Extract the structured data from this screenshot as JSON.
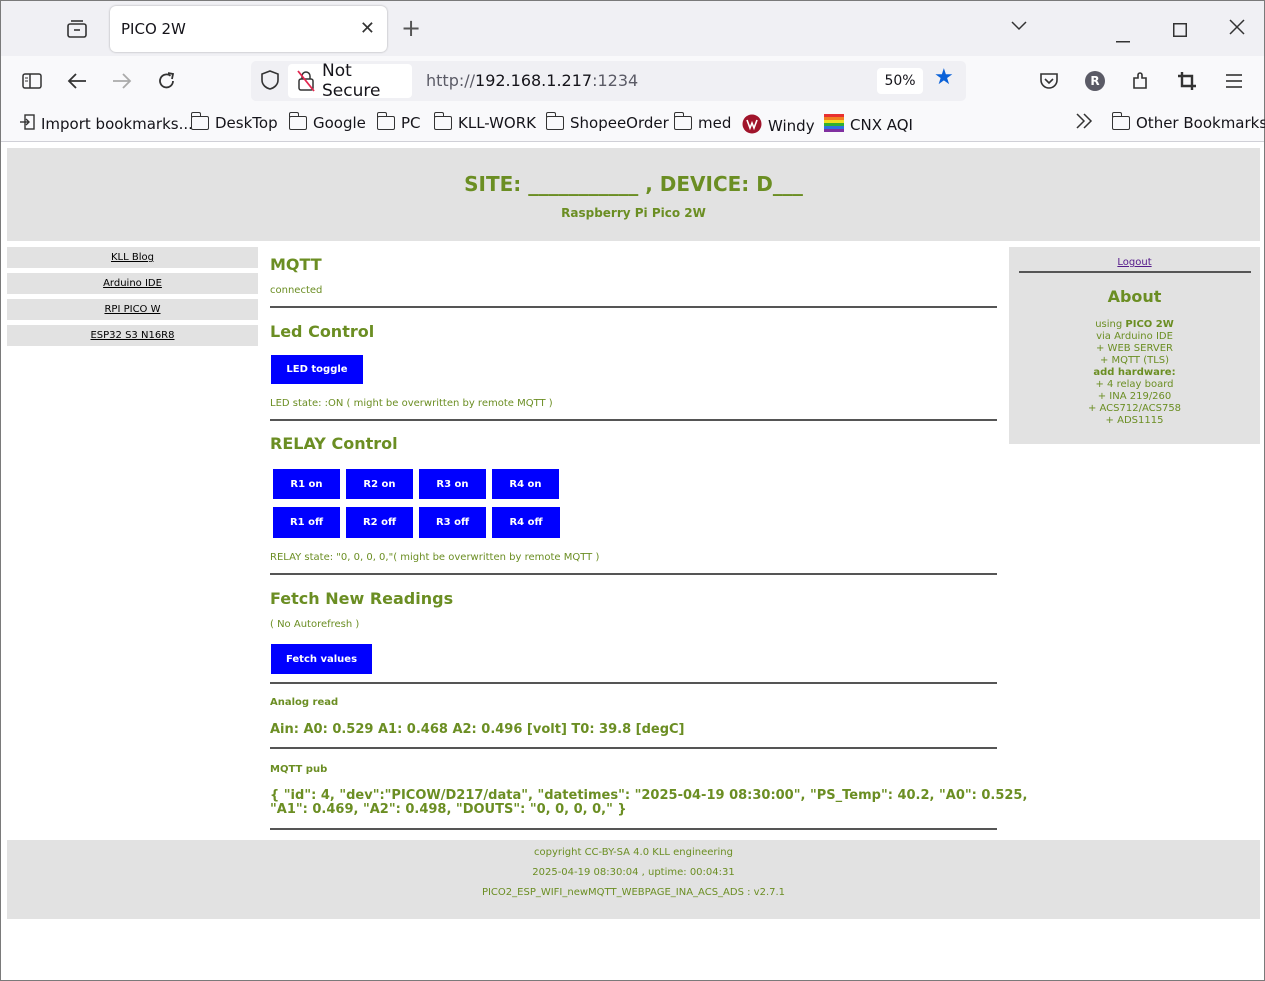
{
  "browser": {
    "tab_title": "PICO 2W",
    "not_secure": "Not Secure",
    "url_prefix": "http://",
    "url_host": "192.168.1.217",
    "url_port": ":1234",
    "zoom": "50%",
    "bookmarks": [
      "Import bookmarks...",
      "DeskTop",
      "Google",
      "PC",
      "KLL-WORK",
      "ShopeeOrder",
      "med",
      "Windy",
      "CNX AQI"
    ],
    "other_bookmarks": "Other Bookmarks",
    "profile_initial": "R"
  },
  "header": {
    "title": "SITE: ___________ , DEVICE: D___",
    "subtitle": "Raspberry Pi Pico 2W"
  },
  "leftnav": [
    "KLL Blog",
    "Arduino IDE",
    "RPI PICO W",
    "ESP32 S3 N16R8"
  ],
  "mqtt": {
    "title": "MQTT",
    "status": "connected"
  },
  "led": {
    "title": "Led Control",
    "button": "LED toggle",
    "state": "LED state: :ON ( might be overwritten by remote MQTT )"
  },
  "relay": {
    "title": "RELAY Control",
    "on_buttons": [
      "R1 on",
      "R2 on",
      "R3 on",
      "R4 on"
    ],
    "off_buttons": [
      "R1 off",
      "R2 off",
      "R3 off",
      "R4 off"
    ],
    "state": "RELAY state: \"0, 0, 0, 0,\"( might be overwritten by remote MQTT )"
  },
  "fetch": {
    "title": "Fetch New Readings",
    "note": "( No Autorefresh )",
    "button": "Fetch values"
  },
  "analog": {
    "label": "Analog read",
    "value": "Ain: A0: 0.529 A1: 0.468 A2: 0.496 [volt] T0: 39.8 [degC]"
  },
  "mqtt_pub": {
    "label": "MQTT pub",
    "line1": "{ \"id\": 4, \"dev\":\"PICOW/D217/data\", \"datetimes\": \"2025-04-19 08:30:00\", \"PS_Temp\": 40.2, \"A0\": 0.525,",
    "line2": "\"A1\": 0.469, \"A2\": 0.498, \"DOUTS\": \"0, 0, 0, 0,\" }"
  },
  "right": {
    "logout": "Logout",
    "about": "About",
    "lines": [
      "via Arduino IDE",
      "+ WEB SERVER",
      "+ MQTT (TLS)"
    ],
    "using_prefix": "using ",
    "using_bold": "PICO 2W",
    "add_hw": "add hardware:",
    "hw": [
      "+ 4 relay board",
      "+ INA 219/260",
      "+ ACS712/ACS758",
      "+ ADS1115"
    ]
  },
  "footer": {
    "copyright": "copyright CC-BY-SA 4.0 KLL engineering",
    "time": "2025-04-19 08:30:04 , uptime: 00:04:31",
    "version": "PICO2_ESP_WIFI_newMQTT_WEBPAGE_INA_ACS_ADS : v2.7.1"
  },
  "colors": {
    "accent": "#6b8e23",
    "button": "#0000ff",
    "panel": "#e2e2e2"
  },
  "icons": [
    "tab-list-icon",
    "close-icon",
    "plus-icon",
    "chevron-down-icon",
    "minimize-icon",
    "maximize-icon",
    "sidebar-icon",
    "back-icon",
    "forward-icon",
    "reload-icon",
    "shield-icon",
    "insecure-lock-icon",
    "star-icon",
    "pocket-icon",
    "profile-icon",
    "extensions-icon",
    "crop-icon",
    "menu-icon",
    "import-icon",
    "folder-icon",
    "windy-icon",
    "cnx-aqi-icon",
    "chevrons-right-icon"
  ]
}
